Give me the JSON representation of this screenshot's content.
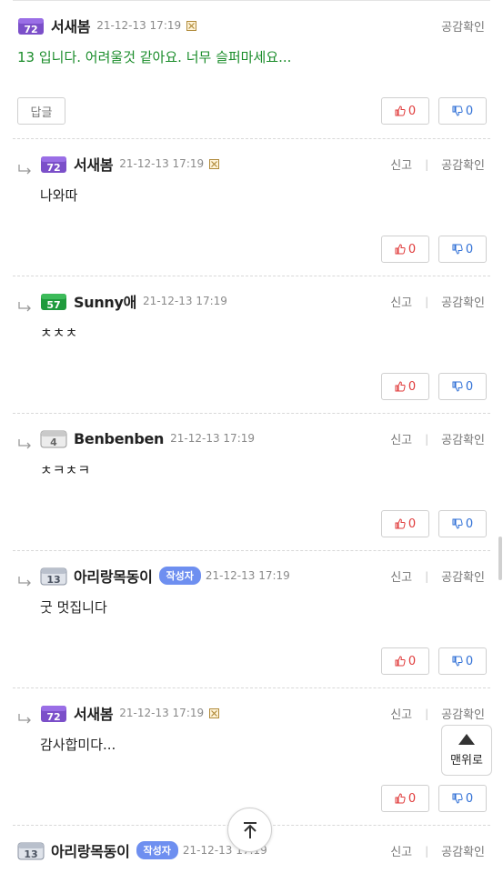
{
  "colors": {
    "body_green": "#1a8c2a",
    "like_red": "#e03c3c",
    "dislike_blue": "#2f6fd6",
    "writer_tag": "#6e8ff0"
  },
  "labels": {
    "report": "신고",
    "divider": "|",
    "empathy_check": "공감확인",
    "reply": "답글",
    "writer": "작성자",
    "to_top": "맨위로"
  },
  "comments": [
    {
      "nickname": "서새봄",
      "level": "72",
      "level_color": "purple",
      "date": "21-12-13 17:19",
      "has_x_icon": true,
      "is_reply": false,
      "text": "13 입니다. 어려울것 같아요. 너무 슬퍼마세요...",
      "likes": "0",
      "dislikes": "0"
    },
    {
      "nickname": "서새봄",
      "level": "72",
      "level_color": "purple",
      "date": "21-12-13 17:19",
      "has_x_icon": true,
      "is_reply": true,
      "text": "나와따",
      "likes": "0",
      "dislikes": "0"
    },
    {
      "nickname": "Sunny애",
      "level": "57",
      "level_color": "green",
      "date": "21-12-13 17:19",
      "has_x_icon": false,
      "is_reply": true,
      "text": "ㅊㅊㅊ",
      "likes": "0",
      "dislikes": "0"
    },
    {
      "nickname": "Benbenben",
      "level": "4",
      "level_color": "gray",
      "date": "21-12-13 17:19",
      "has_x_icon": false,
      "is_reply": true,
      "text": "ㅊㅋㅊㅋ",
      "likes": "0",
      "dislikes": "0"
    },
    {
      "nickname": "아리랑목동이",
      "level": "13",
      "level_color": "gray",
      "date": "21-12-13 17:19",
      "has_x_icon": false,
      "is_reply": true,
      "is_writer": true,
      "text": "굿 멋집니다",
      "likes": "0",
      "dislikes": "0"
    },
    {
      "nickname": "서새봄",
      "level": "72",
      "level_color": "purple",
      "date": "21-12-13 17:19",
      "has_x_icon": true,
      "is_reply": true,
      "text": "감사합미다...",
      "likes": "0",
      "dislikes": "0"
    },
    {
      "nickname": "아리랑목동이",
      "level": "13",
      "level_color": "gray",
      "date": "21-12-13 17:19",
      "has_x_icon": false,
      "is_reply": false,
      "is_writer": true,
      "text": "",
      "likes": "",
      "dislikes": ""
    }
  ]
}
